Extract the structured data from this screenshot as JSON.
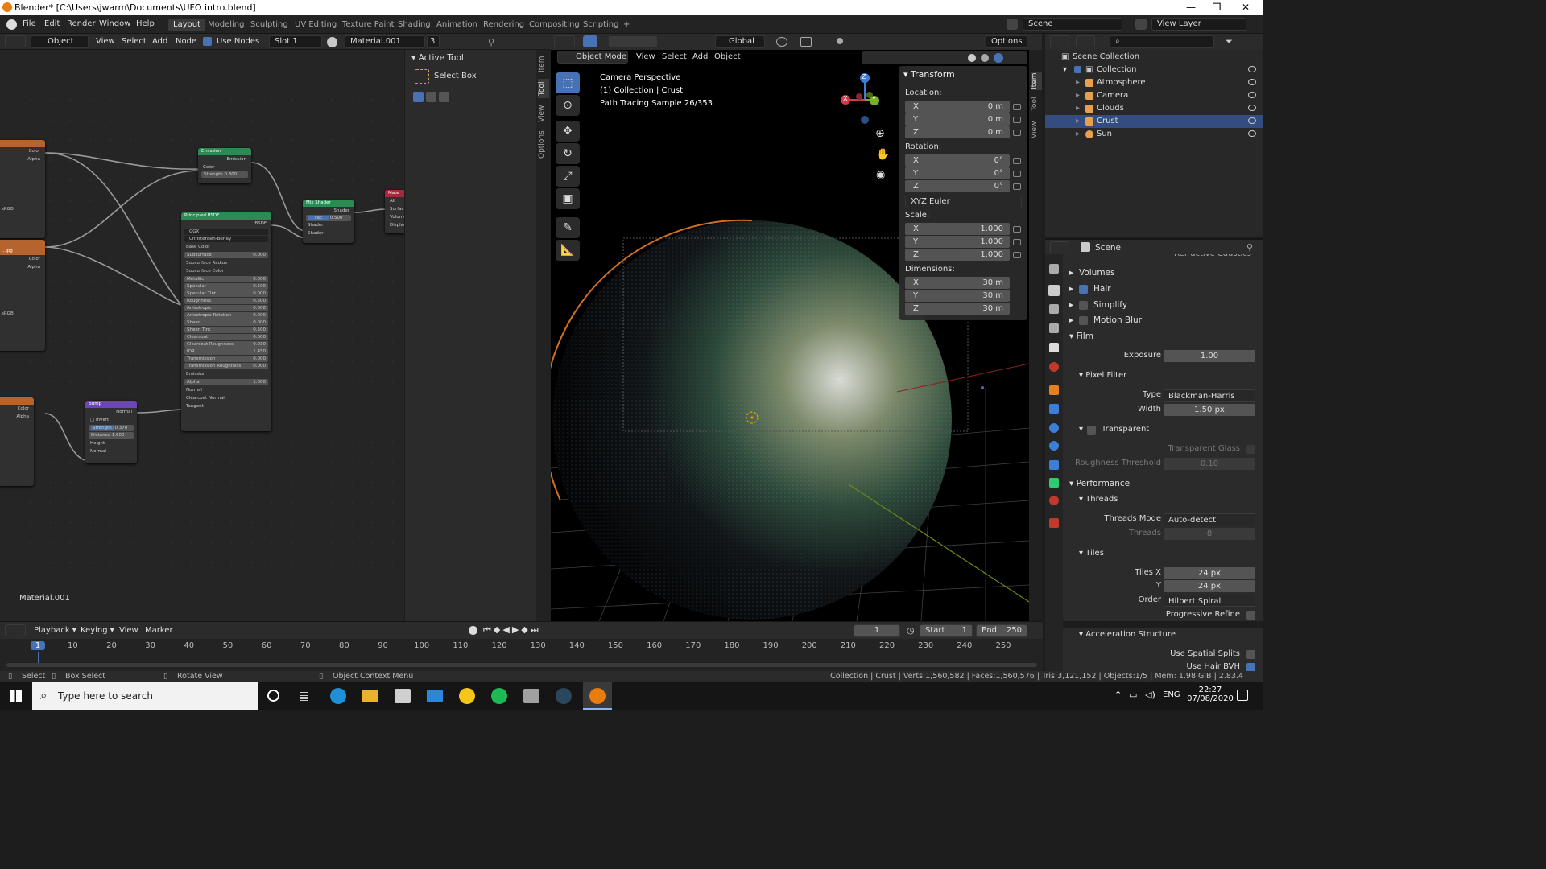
{
  "window": {
    "title": "Blender* [C:\\Users\\jwarm\\Documents\\UFO intro.blend]",
    "minimize": "—",
    "maximize": "❐",
    "close": "✕"
  },
  "topbar": {
    "menus": [
      "File",
      "Edit",
      "Render",
      "Window",
      "Help"
    ],
    "workspaces": [
      "Layout",
      "Modeling",
      "Sculpting",
      "UV Editing",
      "Texture Paint",
      "Shading",
      "Animation",
      "Rendering",
      "Compositing",
      "Scripting"
    ],
    "active_workspace": "Layout",
    "add_tab": "+",
    "scene": "Scene",
    "view_layer": "View Layer"
  },
  "node_header": {
    "object_type": "Object",
    "view": "View",
    "select": "Select",
    "add": "Add",
    "node": "Node",
    "use_nodes": "Use Nodes",
    "slot": "Slot 1",
    "material": "Material.001",
    "users": "3"
  },
  "active_tool": {
    "title": "Active Tool",
    "tool": "Select Box"
  },
  "side_tabs": [
    "Item",
    "Tool",
    "View",
    "Options"
  ],
  "node_editor": {
    "material_label": "Material.001",
    "nodes": {
      "emission": {
        "title": "Emission",
        "out": "Emission",
        "color": "Color",
        "strength_label": "Strength",
        "strength": "0.300"
      },
      "mix": {
        "title": "Mix Shader",
        "out": "Shader",
        "fac": "Fac",
        "fac_val": "0.500",
        "in1": "Shader",
        "in2": "Shader"
      },
      "output": {
        "title": "Mate",
        "all": "All",
        "surface": "Surface",
        "volume": "Volume",
        "displace": "Displace"
      },
      "principled": {
        "title": "Principled BSDF",
        "out": "BSDF",
        "dist": "GGX",
        "sss": "Christensen-Burley",
        "rows": [
          [
            "Base Color",
            ""
          ],
          [
            "Subsurface",
            "0.000"
          ],
          [
            "Subsurface Radius",
            ""
          ],
          [
            "Subsurface Color",
            ""
          ],
          [
            "Metallic",
            "0.000"
          ],
          [
            "Specular",
            "0.500"
          ],
          [
            "Specular Tint",
            "0.000"
          ],
          [
            "Roughness",
            "0.500"
          ],
          [
            "Anisotropic",
            "0.000"
          ],
          [
            "Anisotropic Rotation",
            "0.000"
          ],
          [
            "Sheen",
            "0.000"
          ],
          [
            "Sheen Tint",
            "0.500"
          ],
          [
            "Clearcoat",
            "0.000"
          ],
          [
            "Clearcoat Roughness",
            "0.030"
          ],
          [
            "IOR",
            "1.450"
          ],
          [
            "Transmission",
            "0.000"
          ],
          [
            "Transmission Roughness",
            "0.000"
          ],
          [
            "Emission",
            ""
          ],
          [
            "Alpha",
            "1.000"
          ],
          [
            "Normal",
            ""
          ],
          [
            "Clearcoat Normal",
            ""
          ],
          [
            "Tangent",
            ""
          ]
        ]
      },
      "bump": {
        "title": "Bump",
        "out": "Normal",
        "invert": "Invert",
        "strength_label": "Strength",
        "strength": "0.370",
        "distance_label": "Distance",
        "distance": "1.600",
        "height": "Height",
        "normal": "Normal"
      },
      "tex1": {
        "color": "Color",
        "alpha": "Alpha",
        "cs": "sRGB"
      },
      "tex2": {
        "color": "Color",
        "alpha": "Alpha",
        "cs": "sRGB",
        "name": "...jpg"
      },
      "tex3": {
        "color": "Color",
        "alpha": "Alpha",
        "cs": "sRGB"
      }
    }
  },
  "viewport_header": {
    "orientation": "Global",
    "options": "Options",
    "mode": "Object Mode",
    "view": "View",
    "select": "Select",
    "add": "Add",
    "object": "Object"
  },
  "viewport": {
    "overlay_lines": [
      "Camera Perspective",
      "(1) Collection | Crust",
      "Path Tracing Sample 26/353"
    ],
    "vp_tabs": [
      "Item",
      "Tool",
      "View"
    ],
    "axes": {
      "x": "X",
      "y": "Y",
      "z": "Z"
    }
  },
  "transform": {
    "title": "Transform",
    "location_label": "Location:",
    "location": [
      [
        "X",
        "0 m"
      ],
      [
        "Y",
        "0 m"
      ],
      [
        "Z",
        "0 m"
      ]
    ],
    "rotation_label": "Rotation:",
    "rotation": [
      [
        "X",
        "0°"
      ],
      [
        "Y",
        "0°"
      ],
      [
        "Z",
        "0°"
      ]
    ],
    "rotation_mode": "XYZ Euler",
    "scale_label": "Scale:",
    "scale": [
      [
        "X",
        "1.000"
      ],
      [
        "Y",
        "1.000"
      ],
      [
        "Z",
        "1.000"
      ]
    ],
    "dimensions_label": "Dimensions:",
    "dimensions": [
      [
        "X",
        "30 m"
      ],
      [
        "Y",
        "30 m"
      ],
      [
        "Z",
        "30 m"
      ]
    ]
  },
  "outliner": {
    "root": "Scene Collection",
    "collection": "Collection",
    "items": [
      {
        "name": "Atmosphere",
        "icon": "mesh-icon"
      },
      {
        "name": "Camera",
        "icon": "camera-icon"
      },
      {
        "name": "Clouds",
        "icon": "mesh-icon"
      },
      {
        "name": "Crust",
        "icon": "mesh-icon",
        "selected": true
      },
      {
        "name": "Sun",
        "icon": "light-icon"
      }
    ]
  },
  "properties": {
    "header": "Scene",
    "top_cut": "Refractive Caustics",
    "volumes": "Volumes",
    "hair": "Hair",
    "simplify": "Simplify",
    "motion_blur": "Motion Blur",
    "film": "Film",
    "exposure_label": "Exposure",
    "exposure": "1.00",
    "pixel_filter": "Pixel Filter",
    "type_label": "Type",
    "type": "Blackman-Harris",
    "width_label": "Width",
    "width": "1.50 px",
    "transparent": "Transparent",
    "transparent_glass": "Transparent Glass",
    "roughness_threshold_label": "Roughness Threshold",
    "roughness_threshold": "0.10",
    "performance": "Performance",
    "threads": "Threads",
    "threads_mode_label": "Threads Mode",
    "threads_mode": "Auto-detect",
    "threads_count_label": "Threads",
    "threads_count": "8",
    "tiles": "Tiles",
    "tiles_x_label": "Tiles X",
    "tiles_x": "24 px",
    "tiles_y_label": "Y",
    "tiles_y": "24 px",
    "order_label": "Order",
    "order": "Hilbert Spiral",
    "progressive_refine": "Progressive Refine",
    "accel": "Acceleration Structure",
    "use_spatial_splits": "Use Spatial Splits",
    "use_hair_bvh": "Use Hair BVH"
  },
  "timeline": {
    "playback": "Playback",
    "keying": "Keying",
    "view": "View",
    "marker": "Marker",
    "current_frame": "1",
    "start_label": "Start",
    "start": "1",
    "end_label": "End",
    "end": "250",
    "ticks": [
      "1",
      "10",
      "20",
      "30",
      "40",
      "50",
      "60",
      "70",
      "80",
      "90",
      "100",
      "110",
      "120",
      "130",
      "140",
      "150",
      "160",
      "170",
      "180",
      "190",
      "200",
      "210",
      "220",
      "230",
      "240",
      "250"
    ]
  },
  "statusbar": {
    "select": "Select",
    "box_select": "Box Select",
    "rotate_view": "Rotate View",
    "context_menu": "Object Context Menu",
    "stats": "Collection | Crust | Verts:1,560,582 | Faces:1,560,576 | Tris:3,121,152 | Objects:1/5 | Mem: 1.98 GiB | 2.83.4"
  },
  "taskbar": {
    "search_placeholder": "Type here to search",
    "lang": "ENG",
    "time": "22:27",
    "date": "07/08/2020"
  }
}
